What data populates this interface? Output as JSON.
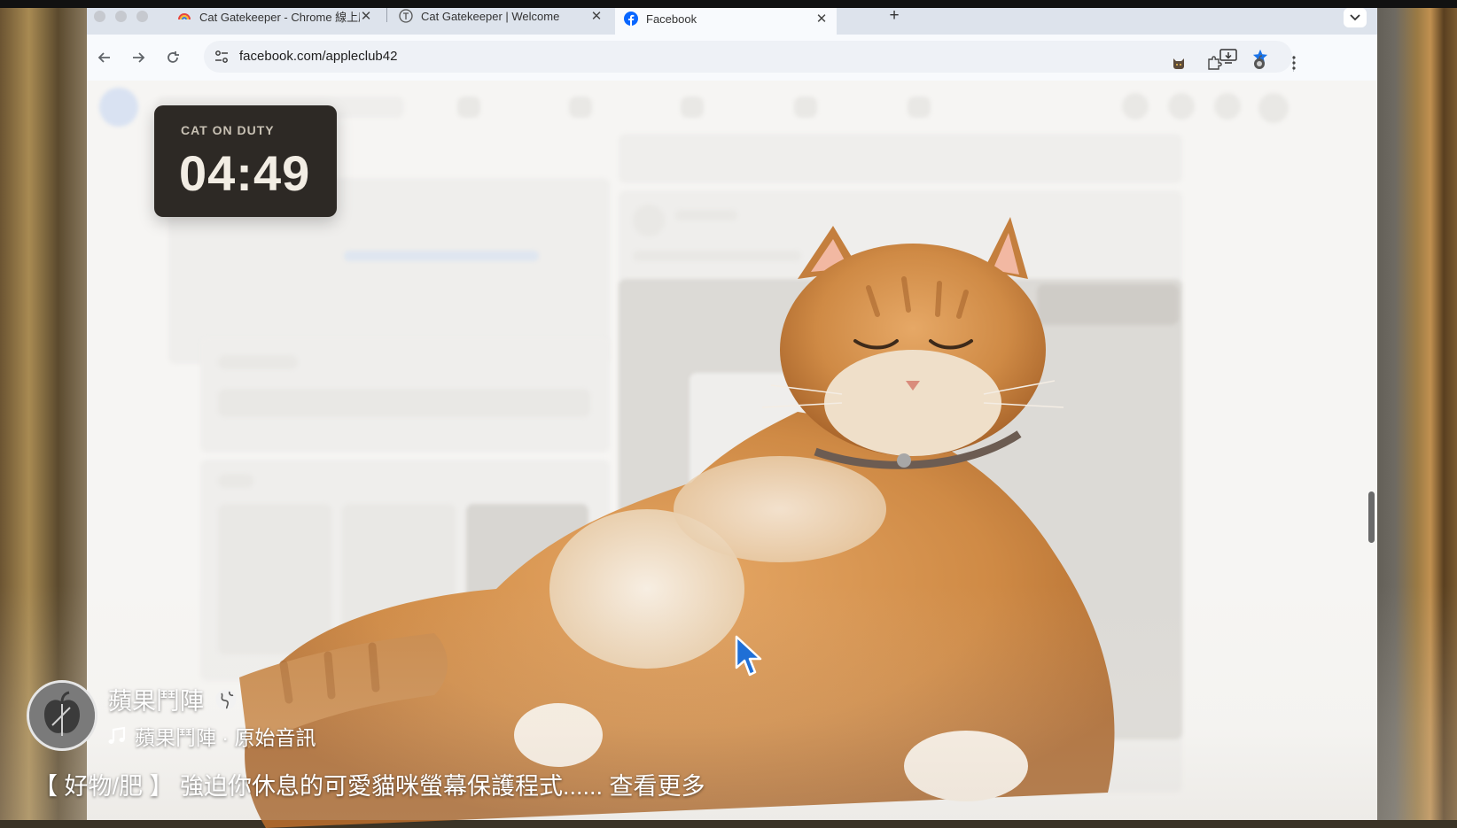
{
  "browser": {
    "tabs": [
      {
        "label": "Cat Gatekeeper - Chrome 線上應用程式商店",
        "icon": "chrome-webstore-icon",
        "active": false
      },
      {
        "label": "Cat Gatekeeper | Welcome",
        "icon": "cat-gatekeeper-icon",
        "active": false
      },
      {
        "label": "Facebook",
        "icon": "facebook-icon",
        "active": true
      }
    ],
    "close_glyph": "✕",
    "new_tab_glyph": "+",
    "url": "facebook.com/appleclub42"
  },
  "timer": {
    "label": "CAT ON DUTY",
    "time": "04:49"
  },
  "video_overlay": {
    "channel_name": "蘋果鬥陣",
    "audio_label": "蘋果鬥陣 · 原始音訊",
    "caption": "【 好物/肥 】 強迫你休息的可愛貓咪螢幕保護程式...... 查看更多"
  },
  "colors": {
    "accent_blue": "#1a73e8",
    "timer_bg": "#2d2925",
    "facebook_blue": "#0866ff"
  }
}
